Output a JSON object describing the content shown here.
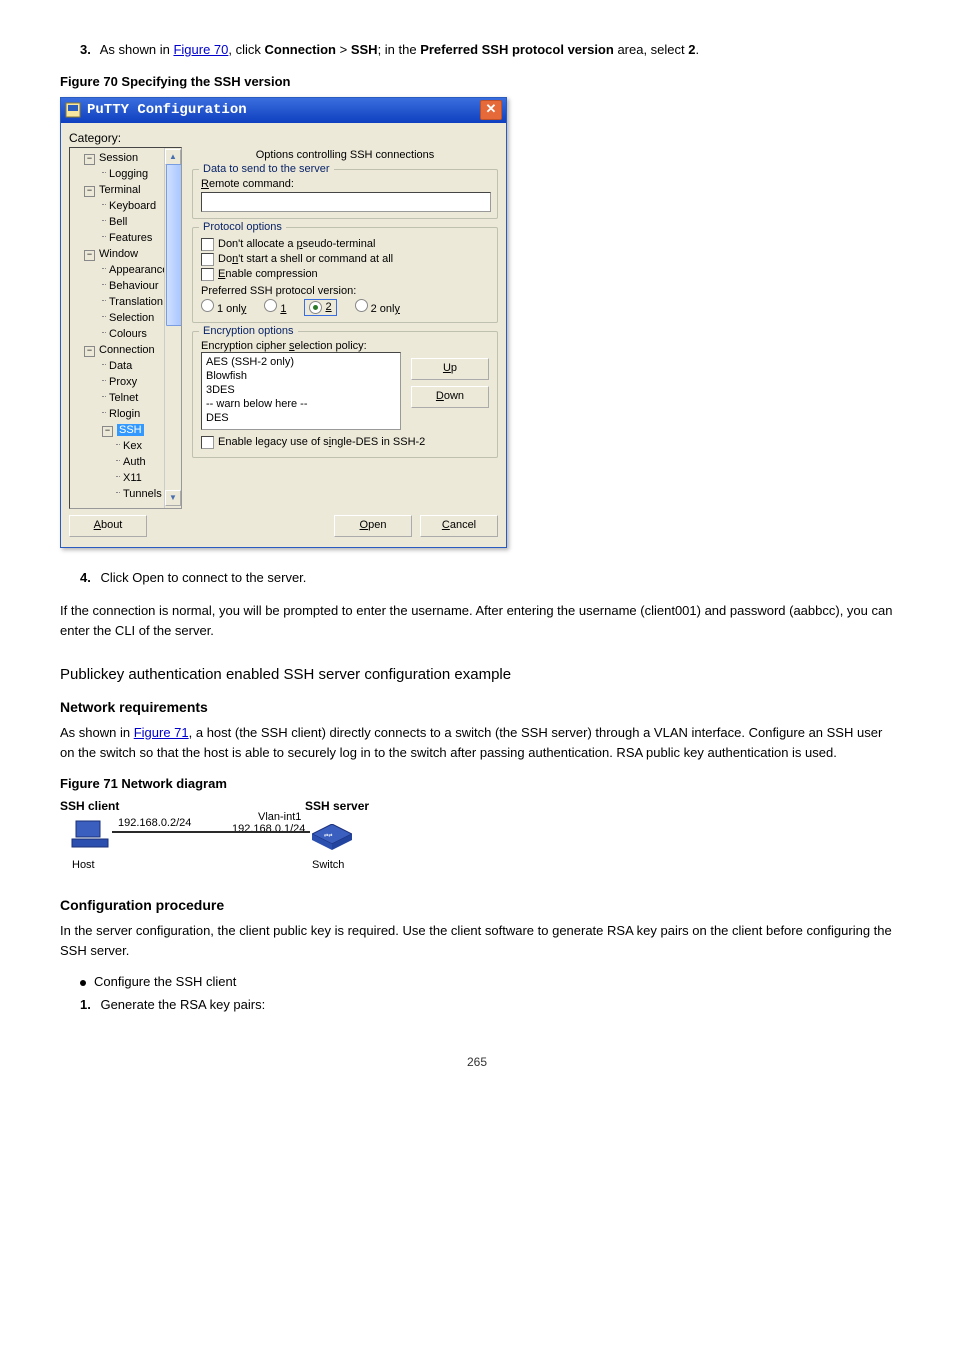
{
  "intro_step_num": "3.",
  "intro_text_1": "As shown in ",
  "intro_link": "Figure 70",
  "intro_text_2": ", click ",
  "intro_conn": "Connection",
  "intro_gt": " > ",
  "intro_ssh": "SSH",
  "intro_text_3": "; in the ",
  "intro_ver": "Preferred SSH protocol version",
  "intro_text_4": " area, select ",
  "intro_two": "2",
  "intro_text_5": ".",
  "fig70_caption": "Figure 70 Specifying the SSH version",
  "putty": {
    "title": "PuTTY Configuration",
    "category_label": "Category:",
    "tree": {
      "session": "Session",
      "logging": "Logging",
      "terminal": "Terminal",
      "keyboard": "Keyboard",
      "bell": "Bell",
      "features": "Features",
      "window": "Window",
      "appearance": "Appearance",
      "behaviour": "Behaviour",
      "translation": "Translation",
      "selection": "Selection",
      "colours": "Colours",
      "connection": "Connection",
      "data": "Data",
      "proxy": "Proxy",
      "telnet": "Telnet",
      "rlogin": "Rlogin",
      "ssh": "SSH",
      "kex": "Kex",
      "auth": "Auth",
      "x11": "X11",
      "tunnels": "Tunnels"
    },
    "panel_title": "Options controlling SSH connections",
    "group_data": "Data to send to the server",
    "remote_cmd": "Remote command:",
    "group_proto": "Protocol options",
    "chk_pseudo": "Don't allocate a pseudo-terminal",
    "chk_noshell": "Don't start a shell or command at all",
    "chk_compress": "Enable compression",
    "pref_ver": "Preferred SSH protocol version:",
    "r1": "1 only",
    "r2": "1",
    "r3": "2",
    "r4": "2 only",
    "group_enc": "Encryption options",
    "enc_policy": "Encryption cipher selection policy:",
    "ciphers": {
      "c0": "AES (SSH-2 only)",
      "c1": "Blowfish",
      "c2": "3DES",
      "c3": "-- warn below here --",
      "c4": "DES"
    },
    "btn_up": "Up",
    "btn_down": "Down",
    "chk_legacy": "Enable legacy use of single-DES in SSH-2",
    "btn_about": "About",
    "btn_open": "Open",
    "btn_cancel": "Cancel"
  },
  "step4_num": "4.",
  "step4_text": "Click Open to connect to the server.",
  "step_login": "If the connection is normal, you will be prompted to enter the username. After entering the username (client001) and password (aabbcc), you can enter the CLI of the server.",
  "h2": "Publickey authentication enabled SSH server configuration example",
  "h3_net": "Network requirements",
  "net_1": "As shown in ",
  "net_link": "Figure 71",
  "net_2": ", a host (the SSH client) directly connects to a switch (the SSH server) through a VLAN interface. Configure an SSH user on the switch so that the host is able to securely log in to the switch after passing authentication. RSA public key authentication is used.",
  "fig71_caption": "Figure 71 Network diagram",
  "diagram": {
    "ssh_client": "SSH client",
    "ssh_server": "SSH server",
    "host": "Host",
    "switch": "Switch",
    "vlan": "Vlan-int1",
    "ip_client": "192.168.0.2/24",
    "ip_server": "192.168.0.1/24"
  },
  "h3_proc": "Configuration procedure",
  "proc_intro": "In the server configuration, the client public key is required. Use the client software to generate RSA key pairs on the client before configuring the SSH server.",
  "bullet1": "Configure the SSH client",
  "step1b_num": "1.",
  "step1b_text": "Generate the RSA key pairs:",
  "page_num": "265"
}
